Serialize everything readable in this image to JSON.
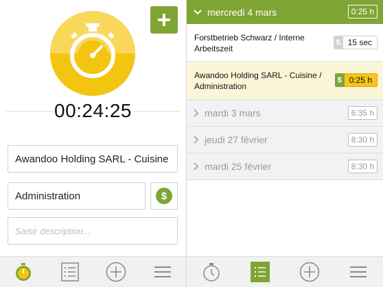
{
  "colors": {
    "accent": "#7fa534",
    "stopwatch_yellow": "#f2c511",
    "stopwatch_light": "#f8d75a",
    "running_duration": "#f5c518",
    "active_entry_bg": "#fbf6d8"
  },
  "timer": {
    "display": "00:24:25"
  },
  "form": {
    "project_value": "Awandoo Holding SARL - Cuisine",
    "task_value": "Administration",
    "billable_symbol": "$",
    "description_placeholder": "Saisir description..."
  },
  "icons": {
    "add": "plus-icon",
    "stopwatch": "stopwatch-icon",
    "billable": "dollar-icon",
    "timer_tab": "stopwatch-icon",
    "list_tab": "list-icon",
    "add_tab": "plus-circle-icon",
    "menu_tab": "hamburger-menu-icon",
    "expand": "chevron-down-icon",
    "collapse": "chevron-right-icon"
  },
  "days": {
    "active": {
      "label": "mercredi 4 mars",
      "total": "0:25 h",
      "entries": [
        {
          "title": "Forstbetrieb Schwarz / Interne Arbeitszeit",
          "currency": "$",
          "duration": "15 sec",
          "billable": false,
          "running": false
        },
        {
          "title": "Awandoo Holding SARL - Cuisine / Administration",
          "currency": "$",
          "duration": "0:25 h",
          "billable": true,
          "running": true
        }
      ]
    },
    "collapsed": [
      {
        "label": "mardi 3 mars",
        "total": "6:35 h"
      },
      {
        "label": "jeudi 27 février",
        "total": "8:30 h"
      },
      {
        "label": "mardi 25 février",
        "total": "8:30 h"
      }
    ]
  }
}
